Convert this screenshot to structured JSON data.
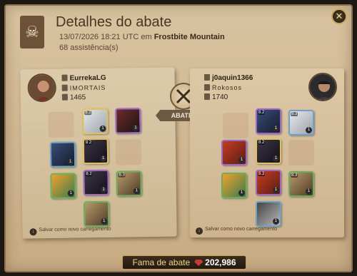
{
  "header": {
    "title": "Detalhes do abate",
    "date": "13/07/2026 18:21 UTC em",
    "location": "Frostbite Mountain",
    "assists": "68 assistência(s)"
  },
  "killer": {
    "name": "EurrekaLG",
    "guild": "IMORTAIS",
    "item_power": "1465",
    "save_label": "Salvar como novo carregamento"
  },
  "victim": {
    "name": "j0aquin1366",
    "guild": "Rokosos",
    "item_power": "1740",
    "save_label": "Salvar como novo carregamento"
  },
  "verdict": {
    "label": "ABATEU"
  },
  "fame": {
    "label": "Fama de abate",
    "value": "202,986"
  },
  "colors": {
    "accent": "#c99a45",
    "panel": "#d9c3a0"
  },
  "icons": [
    "skull-icon",
    "close-icon",
    "crossed-swords-icon",
    "loadout-icon",
    "fame-gem-icon"
  ]
}
